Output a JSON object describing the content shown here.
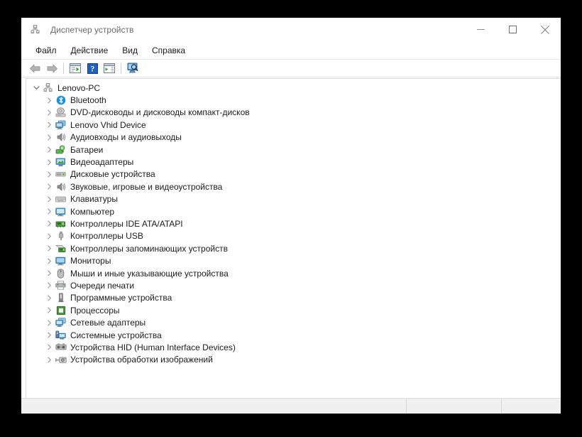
{
  "window": {
    "title": "Диспетчер устройств",
    "title_icon": "device-manager-icon",
    "controls": {
      "minimize": "minimize-icon",
      "maximize": "maximize-icon",
      "close": "close-icon"
    }
  },
  "menu": {
    "items": [
      {
        "label": "Файл",
        "name": "menu-file"
      },
      {
        "label": "Действие",
        "name": "menu-action"
      },
      {
        "label": "Вид",
        "name": "menu-view"
      },
      {
        "label": "Справка",
        "name": "menu-help"
      }
    ]
  },
  "toolbar": {
    "buttons": [
      {
        "name": "back-button",
        "icon": "arrow-left-icon"
      },
      {
        "name": "forward-button",
        "icon": "arrow-right-icon"
      },
      {
        "name": "separator-1",
        "icon": "separator"
      },
      {
        "name": "properties-button",
        "icon": "properties-icon"
      },
      {
        "name": "help-button",
        "icon": "help-question-icon"
      },
      {
        "name": "update-driver-button",
        "icon": "update-driver-icon"
      },
      {
        "name": "separator-2",
        "icon": "separator"
      },
      {
        "name": "scan-hardware-button",
        "icon": "scan-hardware-icon"
      }
    ]
  },
  "tree": {
    "root": {
      "label": "Lenovo-PC",
      "icon": "computer-root-icon",
      "expanded": true,
      "chevron": "chevron-down-icon"
    },
    "items": [
      {
        "label": "Bluetooth",
        "icon": "bluetooth-icon",
        "chevron": "chevron-right-icon"
      },
      {
        "label": "DVD-дисководы и дисководы компакт-дисков",
        "icon": "dvd-drive-icon",
        "chevron": "chevron-right-icon"
      },
      {
        "label": "Lenovo Vhid Device",
        "icon": "display-device-icon",
        "chevron": "chevron-right-icon"
      },
      {
        "label": "Аудиовходы и аудиовыходы",
        "icon": "audio-io-icon",
        "chevron": "chevron-right-icon"
      },
      {
        "label": "Батареи",
        "icon": "battery-icon",
        "chevron": "chevron-right-icon"
      },
      {
        "label": "Видеоадаптеры",
        "icon": "display-adapter-icon",
        "chevron": "chevron-right-icon"
      },
      {
        "label": "Дисковые устройства",
        "icon": "disk-drive-icon",
        "chevron": "chevron-right-icon"
      },
      {
        "label": "Звуковые, игровые и видеоустройства",
        "icon": "sound-video-icon",
        "chevron": "chevron-right-icon"
      },
      {
        "label": "Клавиатуры",
        "icon": "keyboard-icon",
        "chevron": "chevron-right-icon"
      },
      {
        "label": "Компьютер",
        "icon": "computer-icon",
        "chevron": "chevron-right-icon"
      },
      {
        "label": "Контроллеры IDE ATA/ATAPI",
        "icon": "ide-controller-icon",
        "chevron": "chevron-right-icon"
      },
      {
        "label": "Контроллеры USB",
        "icon": "usb-controller-icon",
        "chevron": "chevron-right-icon"
      },
      {
        "label": "Контроллеры запоминающих устройств",
        "icon": "storage-controller-icon",
        "chevron": "chevron-right-icon"
      },
      {
        "label": "Мониторы",
        "icon": "monitor-icon",
        "chevron": "chevron-right-icon"
      },
      {
        "label": "Мыши и иные указывающие устройства",
        "icon": "mouse-icon",
        "chevron": "chevron-right-icon"
      },
      {
        "label": "Очереди печати",
        "icon": "printer-icon",
        "chevron": "chevron-right-icon"
      },
      {
        "label": "Программные устройства",
        "icon": "software-device-icon",
        "chevron": "chevron-right-icon"
      },
      {
        "label": "Процессоры",
        "icon": "processor-icon",
        "chevron": "chevron-right-icon"
      },
      {
        "label": "Сетевые адаптеры",
        "icon": "network-adapter-icon",
        "chevron": "chevron-right-icon"
      },
      {
        "label": "Системные устройства",
        "icon": "system-device-icon",
        "chevron": "chevron-right-icon"
      },
      {
        "label": "Устройства HID (Human Interface Devices)",
        "icon": "hid-device-icon",
        "chevron": "chevron-right-icon"
      },
      {
        "label": "Устройства обработки изображений",
        "icon": "imaging-device-icon",
        "chevron": "chevron-right-icon"
      }
    ]
  },
  "statusbar": {
    "main_text": "",
    "mid_text": "",
    "end_text": ""
  },
  "colors": {
    "window_bg": "#ffffff",
    "desktop_bg": "#000000",
    "title_text": "#6b6b6b",
    "menu_text": "#1a1a1a",
    "tree_text": "#1b1b1b",
    "statusbar_bg": "#f0f0f0",
    "bluetooth_blue": "#1e90d6",
    "accent_green": "#3d9a34",
    "icon_grey": "#8a8a8a",
    "monitor_blue": "#4a90c4"
  }
}
